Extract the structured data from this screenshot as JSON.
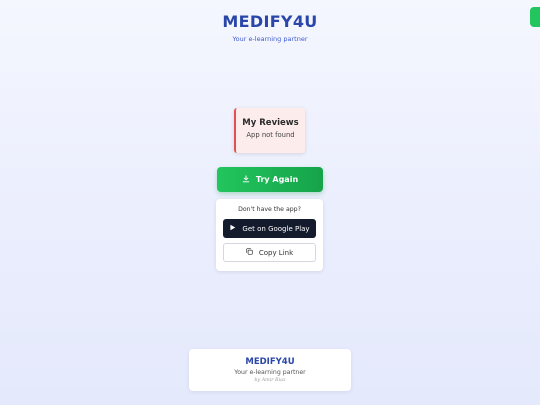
{
  "header": {
    "title": "MEDIFY4U",
    "tagline": "Your e-learning partner"
  },
  "error": {
    "title": "My Reviews",
    "message": "App not found",
    "accent_color": "#e05252"
  },
  "actions": {
    "try_again_label": "Try Again",
    "try_again_icon": "download-icon"
  },
  "app_prompt": {
    "question": "Don't have the app?",
    "google_play_label": "Get on Google Play",
    "google_play_icon": "play-icon",
    "copy_link_label": "Copy Link",
    "copy_link_icon": "copy-icon"
  },
  "footer": {
    "title": "MEDIFY4U",
    "tagline": "Your e-learning partner",
    "byline": "by Amir Riaz"
  },
  "colors": {
    "brand": "#2a46a8",
    "primary_green": "#22c55e",
    "dark_button": "#141b2d"
  }
}
